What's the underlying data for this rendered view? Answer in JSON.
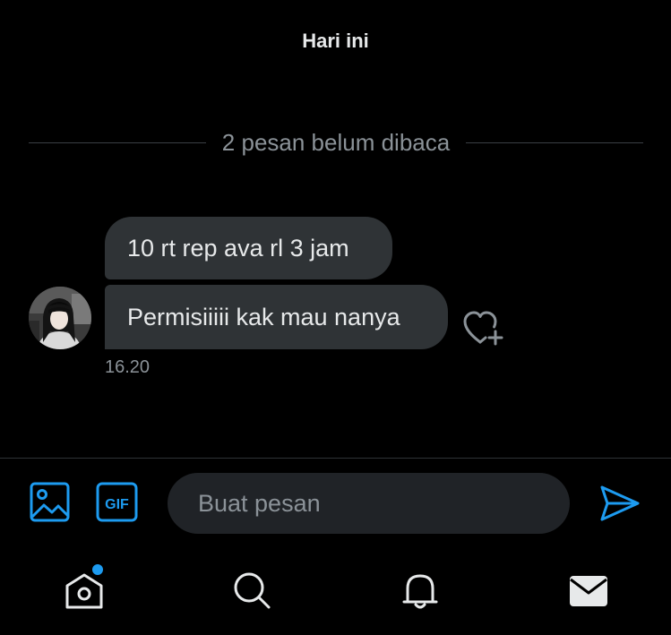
{
  "header": {
    "day_label": "Hari ini"
  },
  "conversation": {
    "unread_divider": "2 pesan belum dibaca",
    "messages": [
      {
        "text": "10 rt rep ava rl 3 jam"
      },
      {
        "text": "Permisiiiii kak mau nanya"
      }
    ],
    "timestamp": "16.20"
  },
  "composer": {
    "media_icon": "image-icon",
    "gif_icon": "gif-icon",
    "gif_label": "GIF",
    "placeholder": "Buat pesan",
    "value": "",
    "send_icon": "send-icon"
  },
  "bottom_nav": {
    "items": [
      {
        "icon": "home-icon",
        "has_badge_dot": true
      },
      {
        "icon": "search-icon"
      },
      {
        "icon": "bell-icon"
      },
      {
        "icon": "mail-icon"
      }
    ]
  },
  "colors": {
    "background": "#000000",
    "bubble": "#2f3336",
    "accent": "#1d9bf0",
    "muted_text": "#8b9298",
    "primary_text": "#e7e9ea",
    "input_bg": "#202327"
  }
}
